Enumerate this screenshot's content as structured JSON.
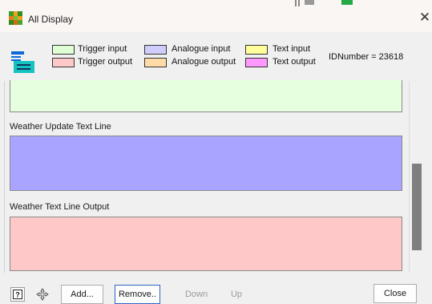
{
  "window": {
    "title": "All Display",
    "icon": "app-logo-icon",
    "close_icon": "close-icon"
  },
  "legend": {
    "icon": "io-list-icon",
    "items": [
      {
        "label": "Trigger input",
        "color": "#dfffd4"
      },
      {
        "label": "Trigger output",
        "color": "#ffc8c8"
      },
      {
        "label": "Analogue input",
        "color": "#d0cdfc"
      },
      {
        "label": "Analogue output",
        "color": "#ffdba8"
      },
      {
        "label": "Text input",
        "color": "#ffff9c"
      },
      {
        "label": "Text output",
        "color": "#ff99ff"
      }
    ],
    "id_text": "IDNumber = 23618"
  },
  "list": {
    "items": [
      {
        "label": "",
        "kind": "Trigger input",
        "color": "#e6ffde"
      },
      {
        "label": "Weather Update Text Line",
        "kind": "Analogue input",
        "color": "#a9a4ff"
      },
      {
        "label": "Weather Text Line Output",
        "kind": "Trigger output",
        "color": "#ffc8c8"
      }
    ]
  },
  "toolbar": {
    "help_icon": "help-icon",
    "move_icon": "move-icon",
    "add_label": "Add...",
    "remove_label": "Remove..",
    "down_label": "Down",
    "up_label": "Up",
    "close_label": "Close"
  }
}
